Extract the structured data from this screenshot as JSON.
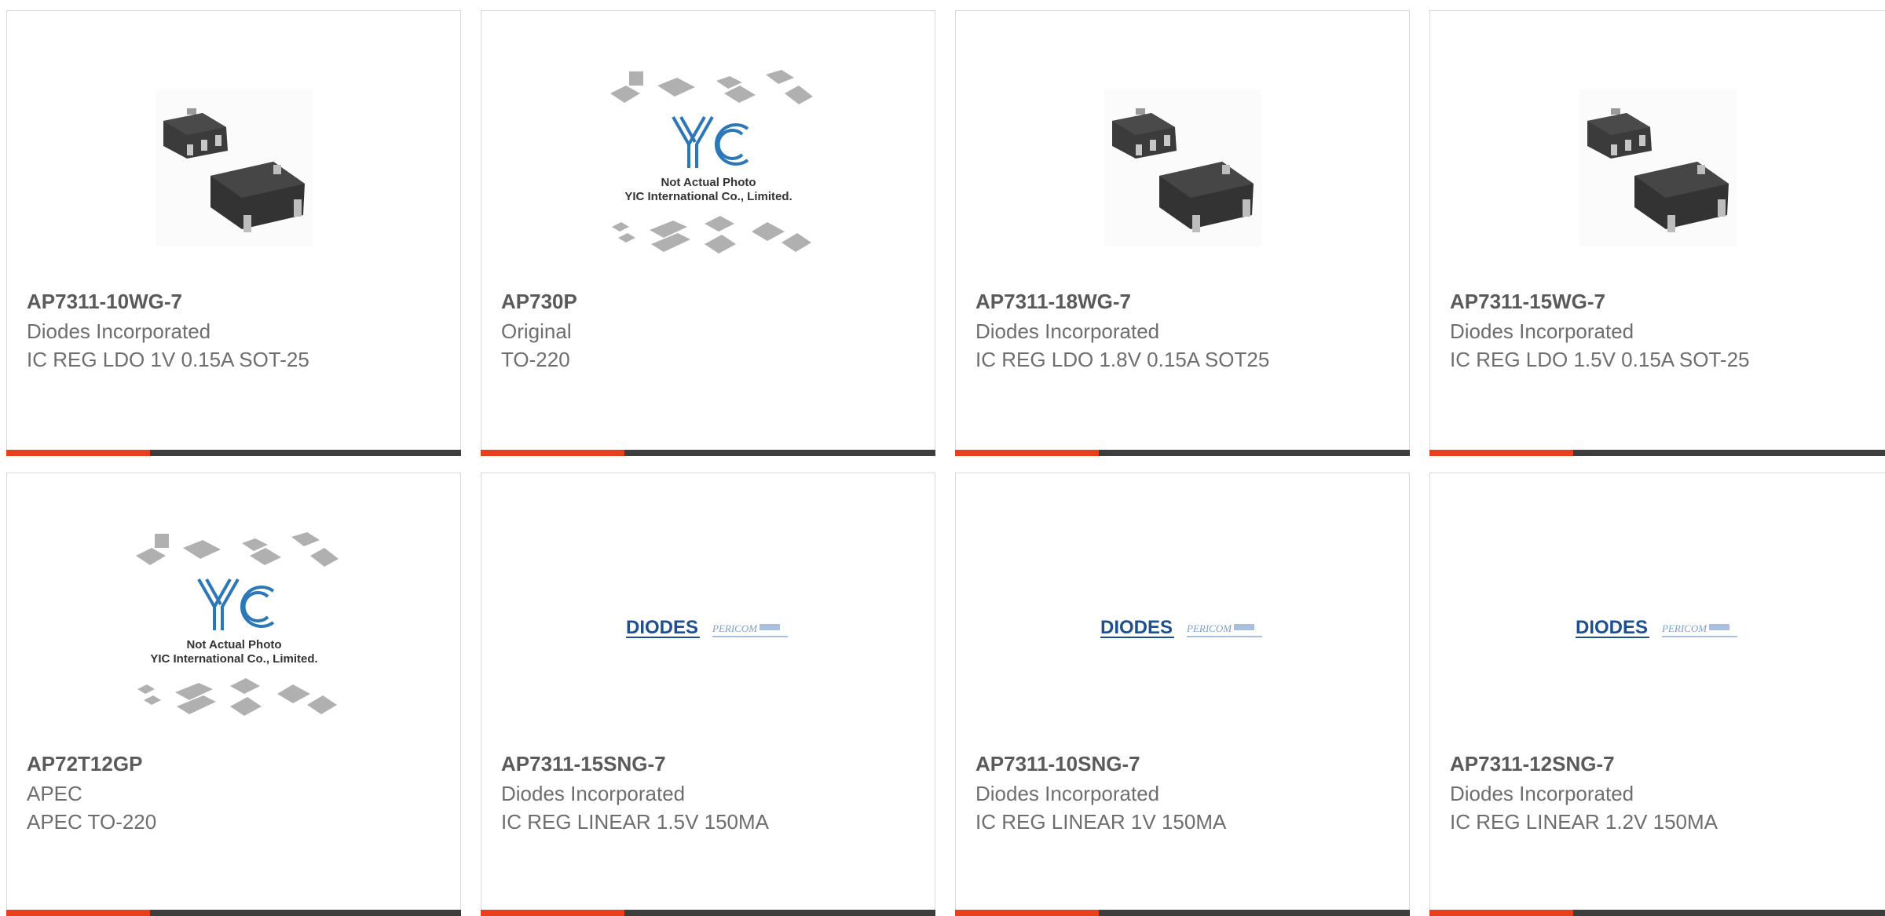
{
  "theme": {
    "accent": "#e8401c",
    "bar": "#3d3d3d"
  },
  "products": [
    {
      "part": "AP7311-10WG-7",
      "manufacturer": "Diodes Incorporated",
      "description": "IC REG LDO 1V 0.15A SOT-25",
      "image": "sot25-package-photo"
    },
    {
      "part": "AP730P",
      "manufacturer": "Original",
      "description": "TO-220",
      "image": "placeholder-yic",
      "placeholder_lines": [
        "Not Actual Photo",
        "YIC International Co., Limited."
      ]
    },
    {
      "part": "AP7311-18WG-7",
      "manufacturer": "Diodes Incorporated",
      "description": "IC REG LDO 1.8V 0.15A SOT25",
      "image": "sot25-package-photo"
    },
    {
      "part": "AP7311-15WG-7",
      "manufacturer": "Diodes Incorporated",
      "description": "IC REG LDO 1.5V 0.15A SOT-25",
      "image": "sot25-package-photo"
    },
    {
      "part": "AP72T12GP",
      "manufacturer": "APEC",
      "description": "APEC TO-220",
      "image": "placeholder-yic",
      "placeholder_lines": [
        "Not Actual Photo",
        "YIC International Co., Limited."
      ]
    },
    {
      "part": "AP7311-15SNG-7",
      "manufacturer": "Diodes Incorporated",
      "description": "IC REG LINEAR 1.5V 150MA",
      "image": "diodes-pericom-logo"
    },
    {
      "part": "AP7311-10SNG-7",
      "manufacturer": "Diodes Incorporated",
      "description": "IC REG LINEAR 1V 150MA",
      "image": "diodes-pericom-logo"
    },
    {
      "part": "AP7311-12SNG-7",
      "manufacturer": "Diodes Incorporated",
      "description": "IC REG LINEAR 1.2V 150MA",
      "image": "diodes-pericom-logo"
    }
  ],
  "logos": {
    "yic": "YIC",
    "diodes": "DIODES",
    "pericom": "PERICOM"
  }
}
